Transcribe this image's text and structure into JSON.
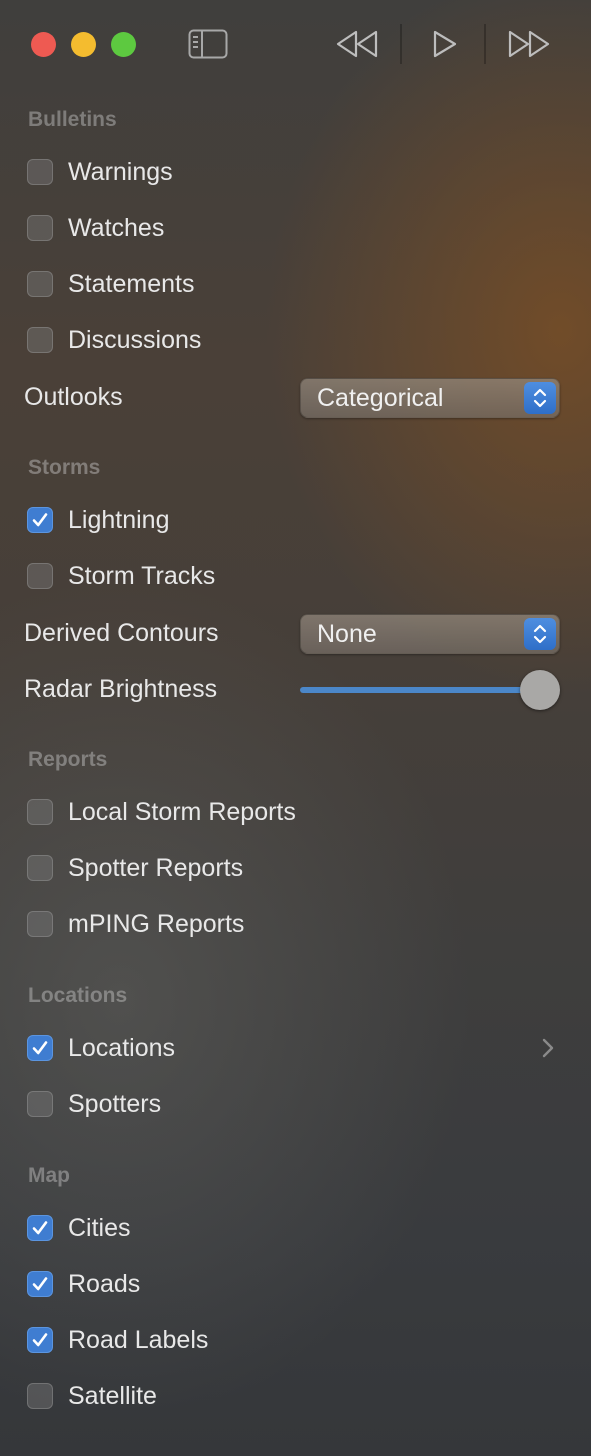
{
  "window": {
    "controls": {
      "close": "close",
      "minimize": "minimize",
      "zoom": "zoom"
    },
    "toolbar": {
      "sidebar_icon": "sidebar-toggle-icon",
      "rewind_icon": "rewind-icon",
      "play_icon": "play-icon",
      "fast_forward_icon": "fast-forward-icon"
    }
  },
  "sections": {
    "bulletins": {
      "header": "Bulletins",
      "items": [
        {
          "label": "Warnings",
          "checked": false
        },
        {
          "label": "Watches",
          "checked": false
        },
        {
          "label": "Statements",
          "checked": false
        },
        {
          "label": "Discussions",
          "checked": false
        }
      ],
      "outlooks": {
        "label": "Outlooks",
        "value": "Categorical"
      }
    },
    "storms": {
      "header": "Storms",
      "items": [
        {
          "label": "Lightning",
          "checked": true
        },
        {
          "label": "Storm Tracks",
          "checked": false
        }
      ],
      "derived_contours": {
        "label": "Derived Contours",
        "value": "None"
      },
      "radar_brightness": {
        "label": "Radar Brightness",
        "value": 1.0
      }
    },
    "reports": {
      "header": "Reports",
      "items": [
        {
          "label": "Local Storm Reports",
          "checked": false
        },
        {
          "label": "Spotter Reports",
          "checked": false
        },
        {
          "label": "mPING Reports",
          "checked": false
        }
      ]
    },
    "locations": {
      "header": "Locations",
      "items": [
        {
          "label": "Locations",
          "checked": true
        },
        {
          "label": "Spotters",
          "checked": false
        }
      ]
    },
    "map": {
      "header": "Map",
      "items": [
        {
          "label": "Cities",
          "checked": true
        },
        {
          "label": "Roads",
          "checked": true
        },
        {
          "label": "Road Labels",
          "checked": true
        },
        {
          "label": "Satellite",
          "checked": false
        }
      ]
    }
  },
  "colors": {
    "accent": "#3f7dd1",
    "close": "#ee5a52",
    "minimize": "#f4bc2f",
    "zoom": "#5dc940"
  }
}
